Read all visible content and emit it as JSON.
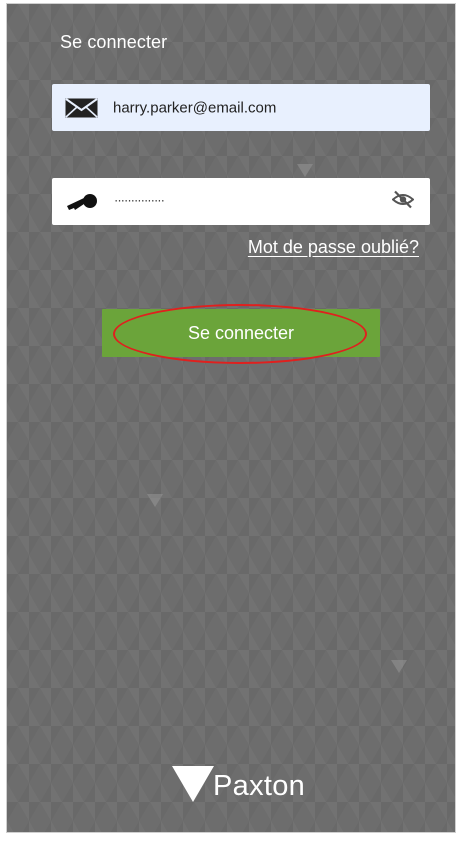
{
  "header": {
    "title": "Se connecter"
  },
  "login_form": {
    "email": {
      "value": "harry.parker@email.com",
      "icon": "envelope-icon"
    },
    "password": {
      "masked_value": "···············",
      "icon": "key-icon",
      "toggle_icon": "eye-off-icon"
    },
    "forgot_password_label": "Mot de passe oublié?",
    "submit_label": "Se connecter"
  },
  "annotation": {
    "highlight_color": "#e0201e"
  },
  "footer": {
    "logo_text": "Paxton",
    "logo_icon": "paxton-triangle-logo"
  },
  "theme": {
    "background": "#6d6d6d",
    "button_color": "#6ba43a",
    "email_field_bg": "#e8f0fe"
  }
}
